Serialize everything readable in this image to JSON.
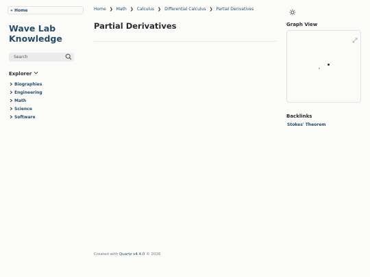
{
  "sidebar": {
    "home_link": "« Home",
    "site_title": "Wave Lab Knowledge",
    "search_placeholder": "Search",
    "explorer_label": "Explorer",
    "explorer_items": [
      {
        "label": "Biographies"
      },
      {
        "label": "Engineering"
      },
      {
        "label": "Math"
      },
      {
        "label": "Science"
      },
      {
        "label": "Software"
      }
    ]
  },
  "breadcrumb": [
    "Home",
    "Math",
    "Calculus",
    "Differential Calculus",
    "Partial Derivatives"
  ],
  "breadcrumb_separator": "❯",
  "main": {
    "title": "Partial Derivatives"
  },
  "footer": {
    "prefix": "Created with",
    "link": "Quartz v4.4.0",
    "suffix": "© 2026"
  },
  "right": {
    "graph_title": "Graph View",
    "backlinks_title": "Backlinks",
    "backlinks": [
      "Stokes' Theorem"
    ]
  },
  "colors": {
    "accent": "#284b63",
    "background": "#fbfbfa",
    "text": "#2b2b2b"
  },
  "icons": [
    "search-icon",
    "chevron-down-icon",
    "chevron-right-icon",
    "sun-icon",
    "expand-icon"
  ]
}
